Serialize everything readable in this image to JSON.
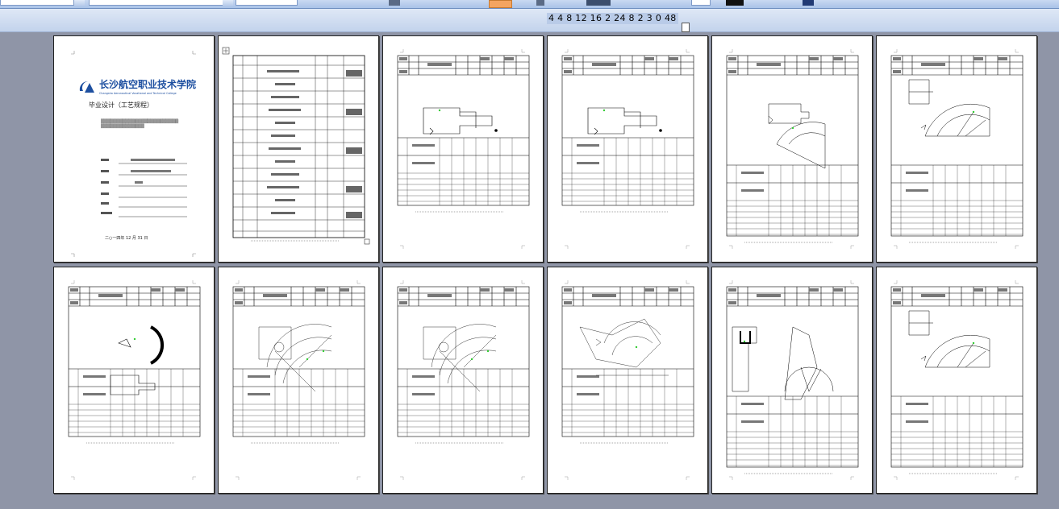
{
  "ruler": {
    "text": "4  4  8 12 16 2 24 8 2 3 0 48"
  },
  "cover": {
    "school_cn": "长沙航空职业技术学院",
    "school_en": "Changsha Aeronautical Vocational and Technical College",
    "title": "毕业设计（工艺规程）",
    "date": "二○一四年  12 月  31 日"
  },
  "pages": [
    {
      "id": 1,
      "kind": "cover"
    },
    {
      "id": 2,
      "kind": "table"
    },
    {
      "id": 3,
      "kind": "card",
      "drawing": "side"
    },
    {
      "id": 4,
      "kind": "card",
      "drawing": "side"
    },
    {
      "id": 5,
      "kind": "card",
      "drawing": "fan-side"
    },
    {
      "id": 6,
      "kind": "card",
      "drawing": "fan"
    },
    {
      "id": 7,
      "kind": "card",
      "drawing": "arc"
    },
    {
      "id": 8,
      "kind": "card",
      "drawing": "complex"
    },
    {
      "id": 9,
      "kind": "card",
      "drawing": "complex"
    },
    {
      "id": 10,
      "kind": "card",
      "drawing": "complex2"
    },
    {
      "id": 11,
      "kind": "card",
      "drawing": "double"
    },
    {
      "id": 12,
      "kind": "card",
      "drawing": "fan"
    }
  ]
}
